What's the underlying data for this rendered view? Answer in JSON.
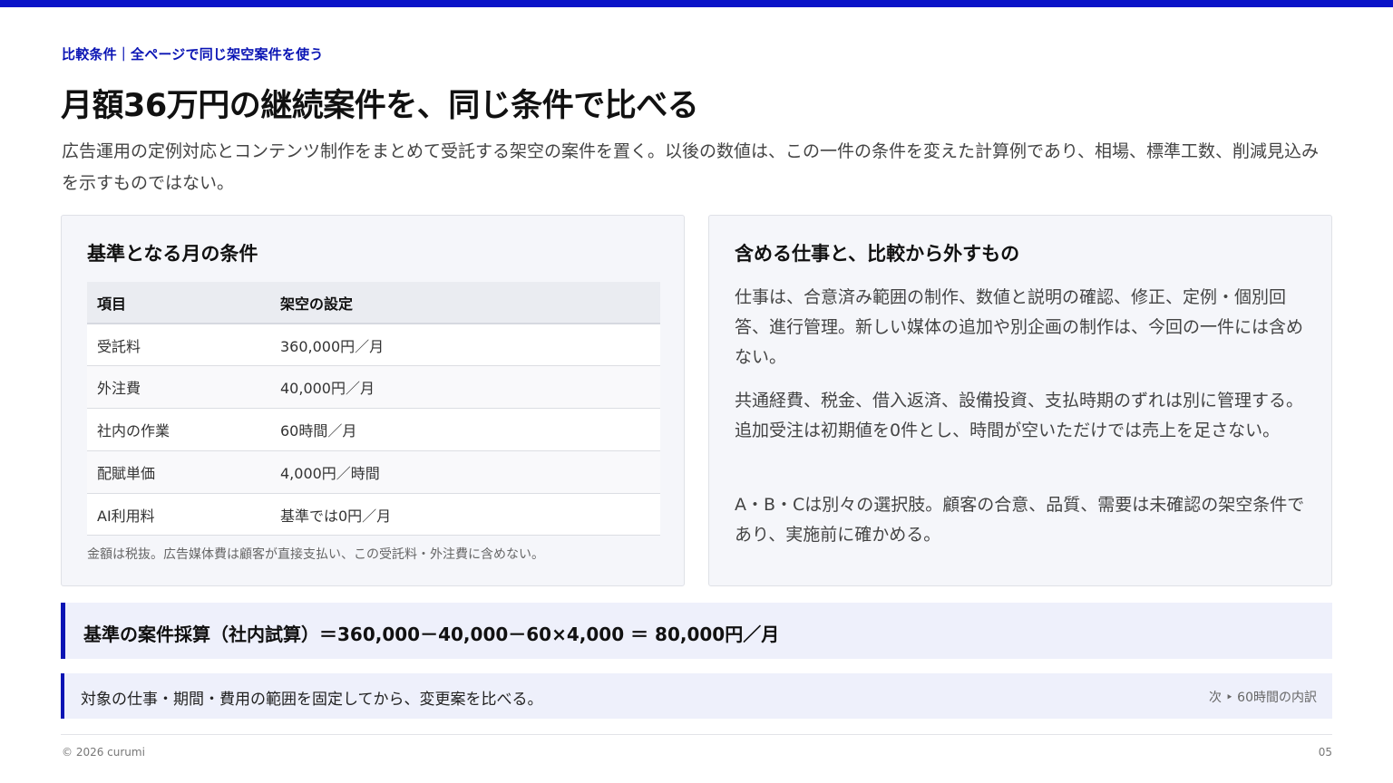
{
  "colors": {
    "accent": "#0a14c8",
    "panel": "#f5f6fa",
    "callout": "#eef0fb"
  },
  "eyebrow": "比較条件｜全ページで同じ架空案件を使う",
  "title": "月額36万円の継続案件を、同じ条件で比べる",
  "lead": "広告運用の定例対応とコンテンツ制作をまとめて受託する架空の案件を置く。以後の数値は、この一件の条件を変えた計算例であり、相場、標準工数、削減見込みを示すものではない。",
  "left_card": {
    "heading": "基準となる月の条件",
    "columns": [
      "項目",
      "架空の設定"
    ],
    "rows": [
      [
        "受託料",
        "360,000円／月"
      ],
      [
        "外注費",
        "40,000円／月"
      ],
      [
        "社内の作業",
        "60時間／月"
      ],
      [
        "配賦単価",
        "4,000円／時間"
      ],
      [
        "AI利用料",
        "基準では0円／月"
      ]
    ],
    "note": "金額は税抜。広告媒体費は顧客が直接支払い、この受託料・外注費に含めない。"
  },
  "right_card": {
    "heading": "含める仕事と、比較から外すもの",
    "paragraphs": [
      "仕事は、合意済み範囲の制作、数値と説明の確認、修正、定例・個別回答、進行管理。新しい媒体の追加や別企画の制作は、今回の一件には含めない。",
      "共通経費、税金、借入返済、設備投資、支払時期のずれは別に管理する。追加受注は初期値を0件とし、時間が空いただけでは売上を足さない。",
      "A・B・Cは別々の選択肢。顧客の合意、品質、需要は未確認の架空条件であり、実施前に確かめる。"
    ]
  },
  "formula": "基準の案件採算（社内試算）＝360,000－40,000－60×4,000 ＝ 80,000円／月",
  "summary": {
    "text": "対象の仕事・期間・費用の範囲を固定してから、変更案を比べる。",
    "next": "次 ‣ 60時間の内訳"
  },
  "footer": {
    "copyright": "© 2026 curumi",
    "page": "05"
  }
}
